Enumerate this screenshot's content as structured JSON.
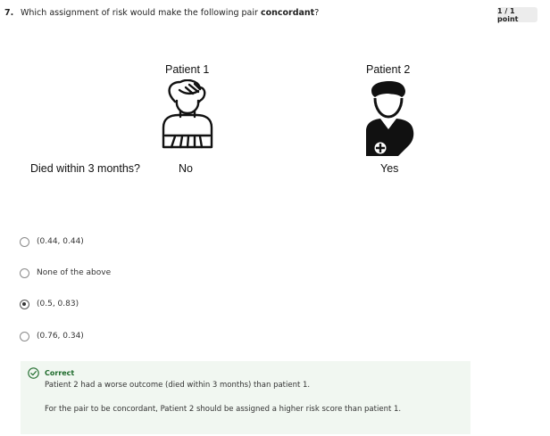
{
  "question": {
    "number": "7.",
    "text_prefix": "Which assignment of risk would make the following pair ",
    "text_bold": "concordant",
    "text_suffix": "?",
    "points": "1 / 1 point"
  },
  "figure": {
    "patient1_label": "Patient 1",
    "patient2_label": "Patient 2",
    "row_label": "Died within 3 months?",
    "patient1_value": "No",
    "patient2_value": "Yes",
    "patient1_icon": "female-patient-icon",
    "patient2_icon": "injured-patient-icon"
  },
  "options": [
    {
      "label": "(0.44, 0.44)",
      "selected": false
    },
    {
      "label": "None of the above",
      "selected": false
    },
    {
      "label": "(0.5, 0.83)",
      "selected": true
    },
    {
      "label": "(0.76, 0.34)",
      "selected": false
    }
  ],
  "feedback": {
    "title": "Correct",
    "line1": "Patient 2 had a worse outcome (died within 3 months) than patient 1.",
    "line2": "For the pair to be concordant, Patient 2 should be assigned a higher risk score than patient 1.",
    "color": "#1e6b2b"
  }
}
